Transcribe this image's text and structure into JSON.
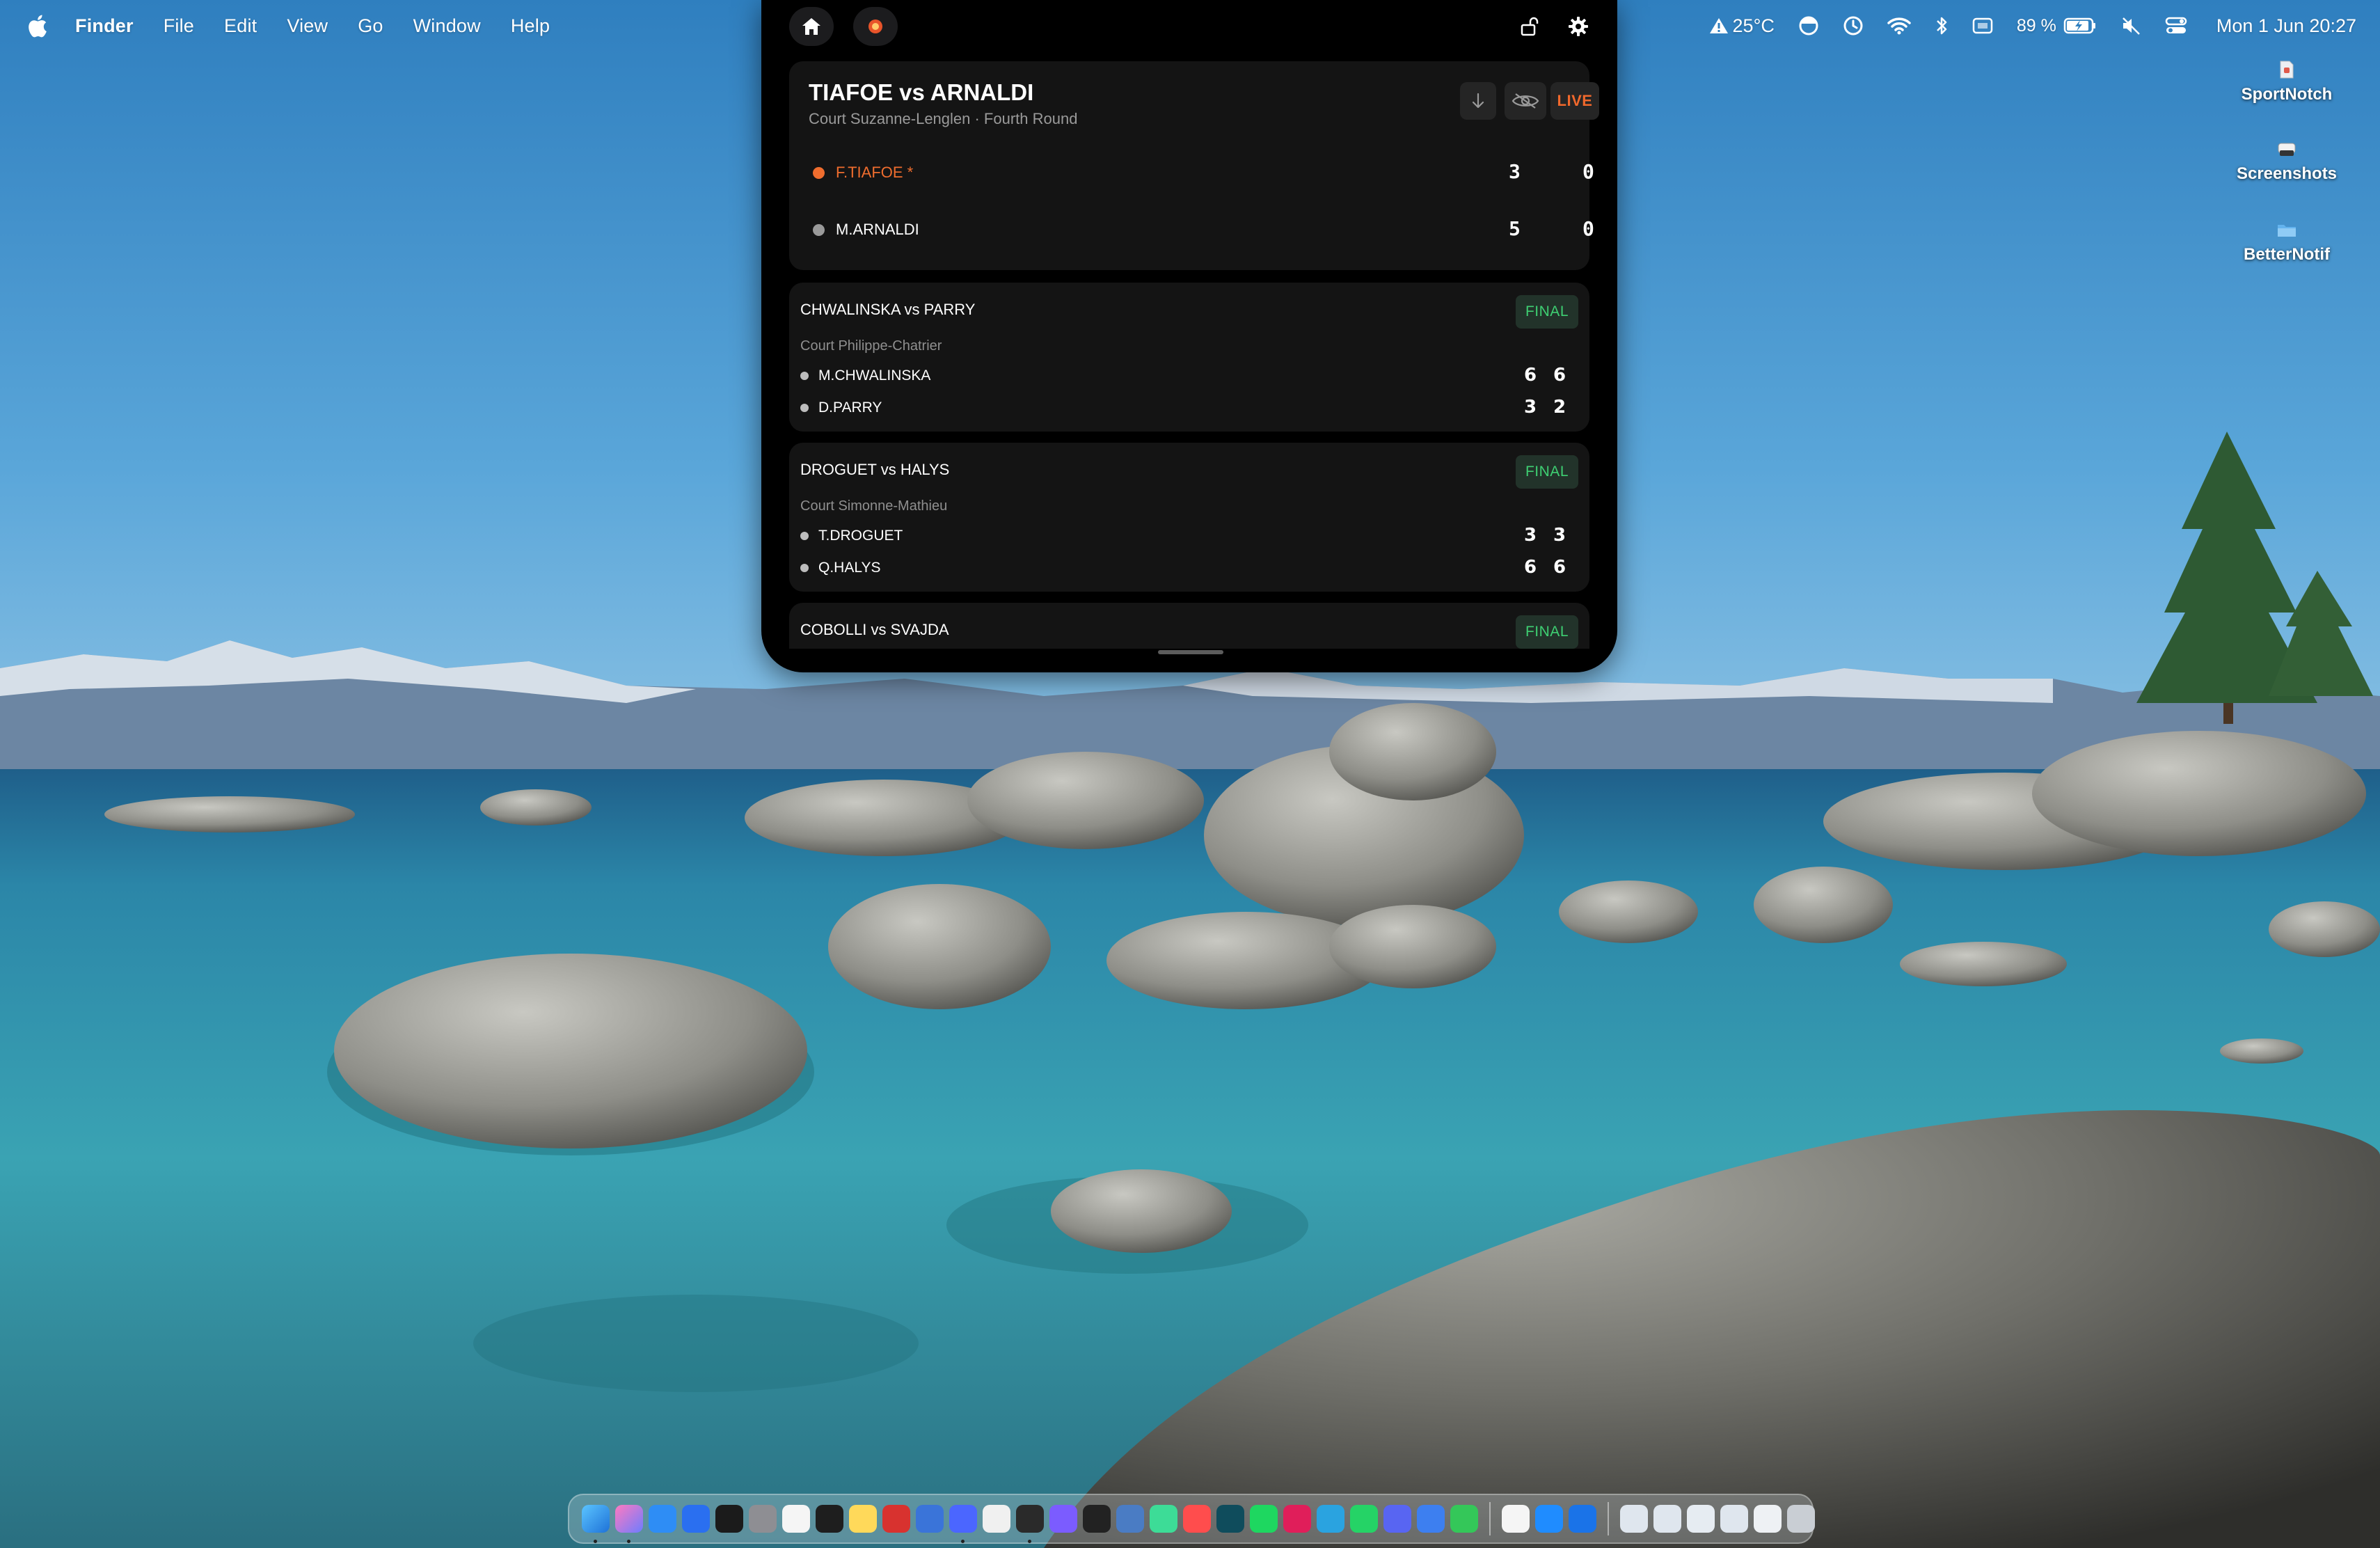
{
  "menubar": {
    "app_name": "Finder",
    "menus": [
      "File",
      "Edit",
      "View",
      "Go",
      "Window",
      "Help"
    ],
    "weather": "25°C",
    "battery": "89 %",
    "clock": "Mon 1 Jun  20:27"
  },
  "notch": {
    "live_match": {
      "title": "TIAFOE vs ARNALDI",
      "subtitle": "Court Suzanne-Lenglen · Fourth Round",
      "status": "LIVE",
      "status_color": "#f0682c",
      "players": [
        {
          "name": "F.TIAFOE *",
          "serving": true,
          "sets": [
            "3",
            "0"
          ]
        },
        {
          "name": "M.ARNALDI",
          "serving": false,
          "sets": [
            "5",
            "0"
          ]
        }
      ]
    },
    "finished_matches": [
      {
        "title": "CHWALINSKA vs PARRY",
        "status": "FINAL",
        "court": "Court Philippe-Chatrier",
        "players": [
          {
            "name": "M.CHWALINSKA",
            "sets": [
              "6",
              "6"
            ]
          },
          {
            "name": "D.PARRY",
            "sets": [
              "3",
              "2"
            ]
          }
        ]
      },
      {
        "title": "DROGUET vs HALYS",
        "status": "FINAL",
        "court": "Court Simonne-Mathieu",
        "players": [
          {
            "name": "T.DROGUET",
            "sets": [
              "3",
              "3"
            ]
          },
          {
            "name": "Q.HALYS",
            "sets": [
              "6",
              "6"
            ]
          }
        ]
      },
      {
        "title": "COBOLLI vs SVAJDA",
        "status": "FINAL"
      }
    ],
    "final_color": "#3ecf72"
  },
  "desktop_icons": [
    {
      "label": "SportNotch",
      "icon": "app-file-icon"
    },
    {
      "label": "Screenshots",
      "icon": "drive-icon"
    },
    {
      "label": "BetterNotif",
      "icon": "folder-icon"
    }
  ]
}
